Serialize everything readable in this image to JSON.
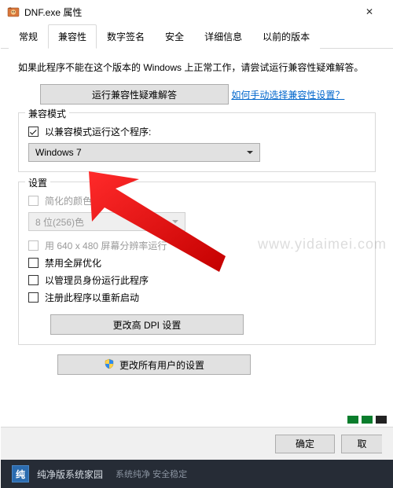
{
  "window": {
    "title": "DNF.exe 属性",
    "close_glyph": "✕"
  },
  "tabs": {
    "items": [
      {
        "label": "常规"
      },
      {
        "label": "兼容性"
      },
      {
        "label": "数字签名"
      },
      {
        "label": "安全"
      },
      {
        "label": "详细信息"
      },
      {
        "label": "以前的版本"
      }
    ],
    "active_index": 1
  },
  "body": {
    "description": "如果此程序不能在这个版本的 Windows 上正常工作，请尝试运行兼容性疑难解答。",
    "troubleshoot_btn": "运行兼容性疑难解答",
    "help_link": "如何手动选择兼容性设置？"
  },
  "compat_mode": {
    "legend": "兼容模式",
    "checkbox_label": "以兼容模式运行这个程序:",
    "checkbox_checked": true,
    "selected_value": "Windows 7"
  },
  "settings": {
    "legend": "设置",
    "reduced_color": {
      "label": "简化的颜色模式",
      "checked": false,
      "disabled": true
    },
    "color_select": {
      "value": "8 位(256)色",
      "disabled": true
    },
    "low_res": {
      "label": "用 640 x 480 屏幕分辨率运行",
      "checked": false,
      "disabled": true
    },
    "disable_fullscreen_opt": {
      "label": "禁用全屏优化",
      "checked": false
    },
    "run_as_admin": {
      "label": "以管理员身份运行此程序",
      "checked": false
    },
    "register_restart": {
      "label": "注册此程序以重新启动",
      "checked": false
    },
    "dpi_btn": "更改高 DPI 设置",
    "all_users_btn": "更改所有用户的设置"
  },
  "buttons": {
    "ok": "确定",
    "cancel": "取"
  },
  "watermark": "www.yidaimei.com",
  "footer": {
    "brand": "纯净版系统家园",
    "slogan": "系统纯净 安全稳定"
  }
}
